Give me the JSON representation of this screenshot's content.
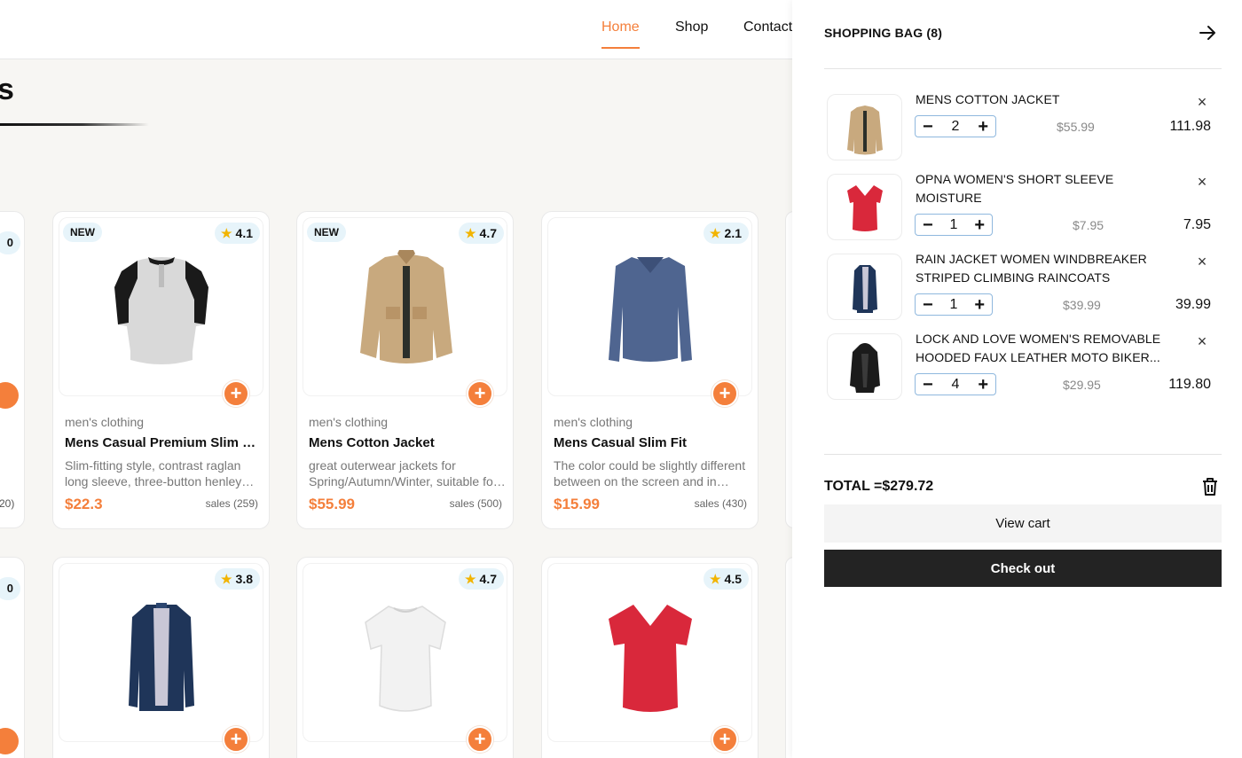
{
  "nav": {
    "items": [
      "Home",
      "Shop",
      "Contact"
    ],
    "active": "Home"
  },
  "section": {
    "title": "s"
  },
  "colors": {
    "accent": "#f47f3b",
    "badge_bg": "#e7f4fa",
    "star": "#f2b400",
    "checkout_bg": "#232323"
  },
  "partial_left": {
    "top_card_badge": "0",
    "sales_fragment": "20)"
  },
  "products": [
    {
      "badge": "NEW",
      "rating": "4.1",
      "category": "men's clothing",
      "title": "Mens Casual Premium Slim Fit T-Shirts",
      "desc": "Slim-fitting style, contrast raglan long sleeve, three-button henley placket",
      "price": "$22.3",
      "sales": "sales (259)",
      "image": "raglan-henley-tshirt"
    },
    {
      "badge": "NEW",
      "rating": "4.7",
      "category": "men's clothing",
      "title": "Mens Cotton Jacket",
      "desc": "great outerwear jackets for Spring/Autumn/Winter, suitable for many occasions",
      "price": "$55.99",
      "sales": "sales (500)",
      "image": "khaki-cotton-jacket"
    },
    {
      "badge": "",
      "rating": "2.1",
      "category": "men's clothing",
      "title": "Mens Casual Slim Fit",
      "desc": "The color could be slightly different between on the screen and in practice",
      "price": "$15.99",
      "sales": "sales (430)",
      "image": "navy-long-sleeve-shirt"
    },
    {
      "badge": "",
      "rating": "3.8",
      "image": "navy-raincoat"
    },
    {
      "badge": "",
      "rating": "4.7",
      "image": "white-womens-tshirt"
    },
    {
      "badge": "",
      "rating": "4.5",
      "image": "red-vneck-tshirt"
    }
  ],
  "add_icon": "+",
  "star_icon": "★",
  "bag": {
    "title": "SHOPPING BAG (8)",
    "close_icon": "arrow-right-icon",
    "items": [
      {
        "name": "MENS COTTON JACKET",
        "qty": "2",
        "unit": "$55.99",
        "total": "111.98",
        "image": "khaki-cotton-jacket"
      },
      {
        "name": "OPNA WOMEN'S SHORT SLEEVE MOISTURE",
        "qty": "1",
        "unit": "$7.95",
        "total": "7.95",
        "image": "red-vneck-tshirt"
      },
      {
        "name": "RAIN JACKET WOMEN WINDBREAKER STRIPED CLIMBING RAINCOATS",
        "qty": "1",
        "unit": "$39.99",
        "total": "39.99",
        "image": "navy-raincoat"
      },
      {
        "name": "LOCK AND LOVE WOMEN'S REMOVABLE HOODED FAUX LEATHER MOTO BIKER...",
        "qty": "4",
        "unit": "$29.95",
        "total": "119.80",
        "image": "black-leather-jacket"
      }
    ],
    "remove_icon": "×",
    "minus": "−",
    "plus": "+",
    "total_label": "TOTAL =$279.72",
    "view_cart": "View cart",
    "checkout": "Check out"
  }
}
